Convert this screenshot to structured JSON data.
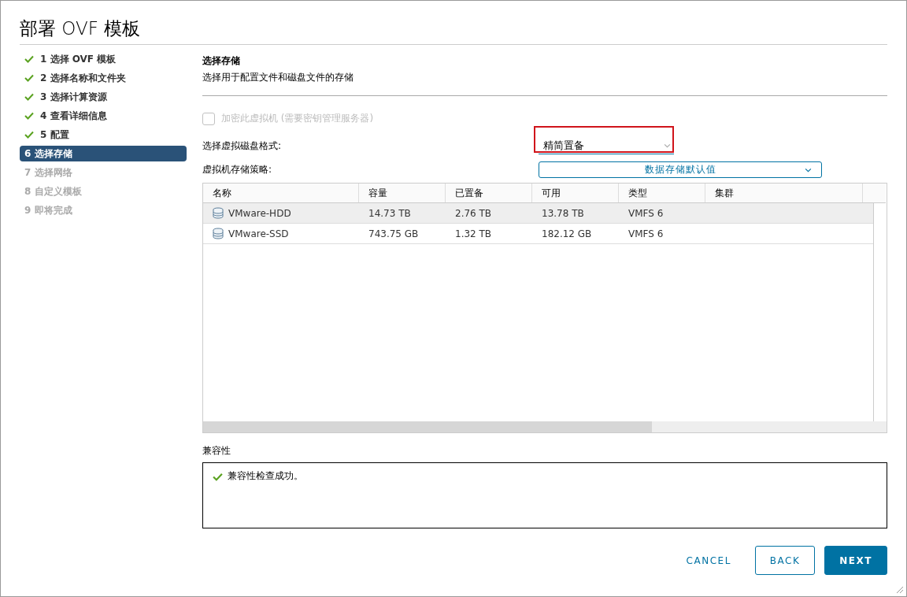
{
  "window": {
    "title": "部署 OVF 模板"
  },
  "steps": [
    {
      "label": "1 选择 OVF 模板",
      "done": true,
      "selected": false
    },
    {
      "label": "2 选择名称和文件夹",
      "done": true,
      "selected": false
    },
    {
      "label": "3 选择计算资源",
      "done": true,
      "selected": false
    },
    {
      "label": "4 查看详细信息",
      "done": true,
      "selected": false
    },
    {
      "label": "5 配置",
      "done": true,
      "selected": false
    },
    {
      "label": "6 选择存储",
      "done": false,
      "selected": true
    },
    {
      "label": "7 选择网络",
      "done": false,
      "selected": false
    },
    {
      "label": "8 自定义模板",
      "done": false,
      "selected": false
    },
    {
      "label": "9 即将完成",
      "done": false,
      "selected": false
    }
  ],
  "page": {
    "title": "选择存储",
    "subtitle": "选择用于配置文件和磁盘文件的存储"
  },
  "encrypt": {
    "label": "加密此虚拟机 (需要密钥管理服务器)",
    "checked": false,
    "disabled": true
  },
  "disk_format": {
    "label": "选择虚拟磁盘格式:",
    "value": "精简置备",
    "highlighted": true
  },
  "storage_policy": {
    "label": "虚拟机存储策略:",
    "value": "数据存储默认值"
  },
  "table": {
    "columns": [
      "名称",
      "容量",
      "已置备",
      "可用",
      "类型",
      "集群"
    ],
    "rows": [
      {
        "selected": true,
        "cells": [
          "VMware-HDD",
          "14.73 TB",
          "2.76 TB",
          "13.78 TB",
          "VMFS 6",
          ""
        ]
      },
      {
        "selected": false,
        "cells": [
          "VMware-SSD",
          "743.75 GB",
          "1.32 TB",
          "182.12 GB",
          "VMFS 6",
          ""
        ]
      }
    ]
  },
  "compatibility": {
    "label": "兼容性",
    "message": "兼容性检查成功。"
  },
  "buttons": [
    {
      "label": "CANCEL",
      "kind": "flat"
    },
    {
      "label": "BACK",
      "kind": "outline"
    },
    {
      "label": "NEXT",
      "kind": "primary"
    }
  ]
}
